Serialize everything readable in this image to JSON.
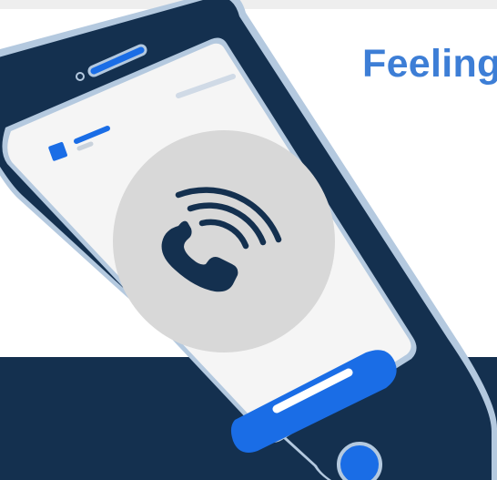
{
  "headline": {
    "text": "Feeling"
  },
  "icons": {
    "phone": "phone-handset-icon",
    "signal": "call-signal-icon"
  },
  "colors": {
    "navy": "#14304f",
    "blue": "#1a6de6",
    "headline_blue": "#3d7ed6",
    "pale_blue": "#b4c9df",
    "circle_grey": "#d8d8d8",
    "screen": "#f5f5f5",
    "top_band": "#eeeeee"
  }
}
